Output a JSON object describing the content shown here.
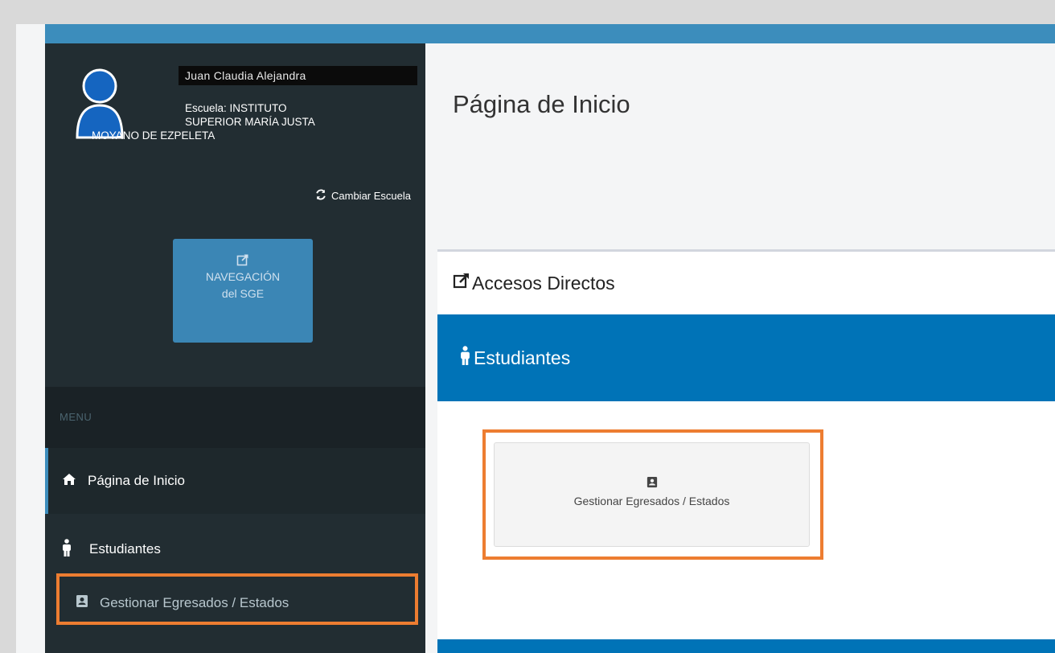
{
  "user": {
    "name": "Juan Claudia Alejandra",
    "school_line1": "Escuela: INSTITUTO",
    "school_line2": "SUPERIOR MARÍA JUSTA",
    "school_line3": "MOYANO DE EZPELETA",
    "change_school": "Cambiar Escuela"
  },
  "nav_button": {
    "line1": "NAVEGACIÓN",
    "line2": "del SGE",
    "icon": "external-link-icon"
  },
  "menu": {
    "header": "MENU",
    "items": [
      {
        "label": "Página de Inicio",
        "icon": "home-icon"
      },
      {
        "label": "Estudiantes",
        "icon": "male-icon"
      },
      {
        "label": "Gestionar Egresados / Estados",
        "icon": "contact-card-icon"
      }
    ]
  },
  "main": {
    "title": "Página de Inicio",
    "panel_title": "Accesos Directos",
    "section_title": "Estudiantes",
    "tile_label": "Gestionar Egresados / Estados"
  },
  "colors": {
    "topbar": "#3c8dbc",
    "sidebar": "#222d32",
    "section_blue": "#0073b7",
    "highlight": "#ed7d31"
  }
}
